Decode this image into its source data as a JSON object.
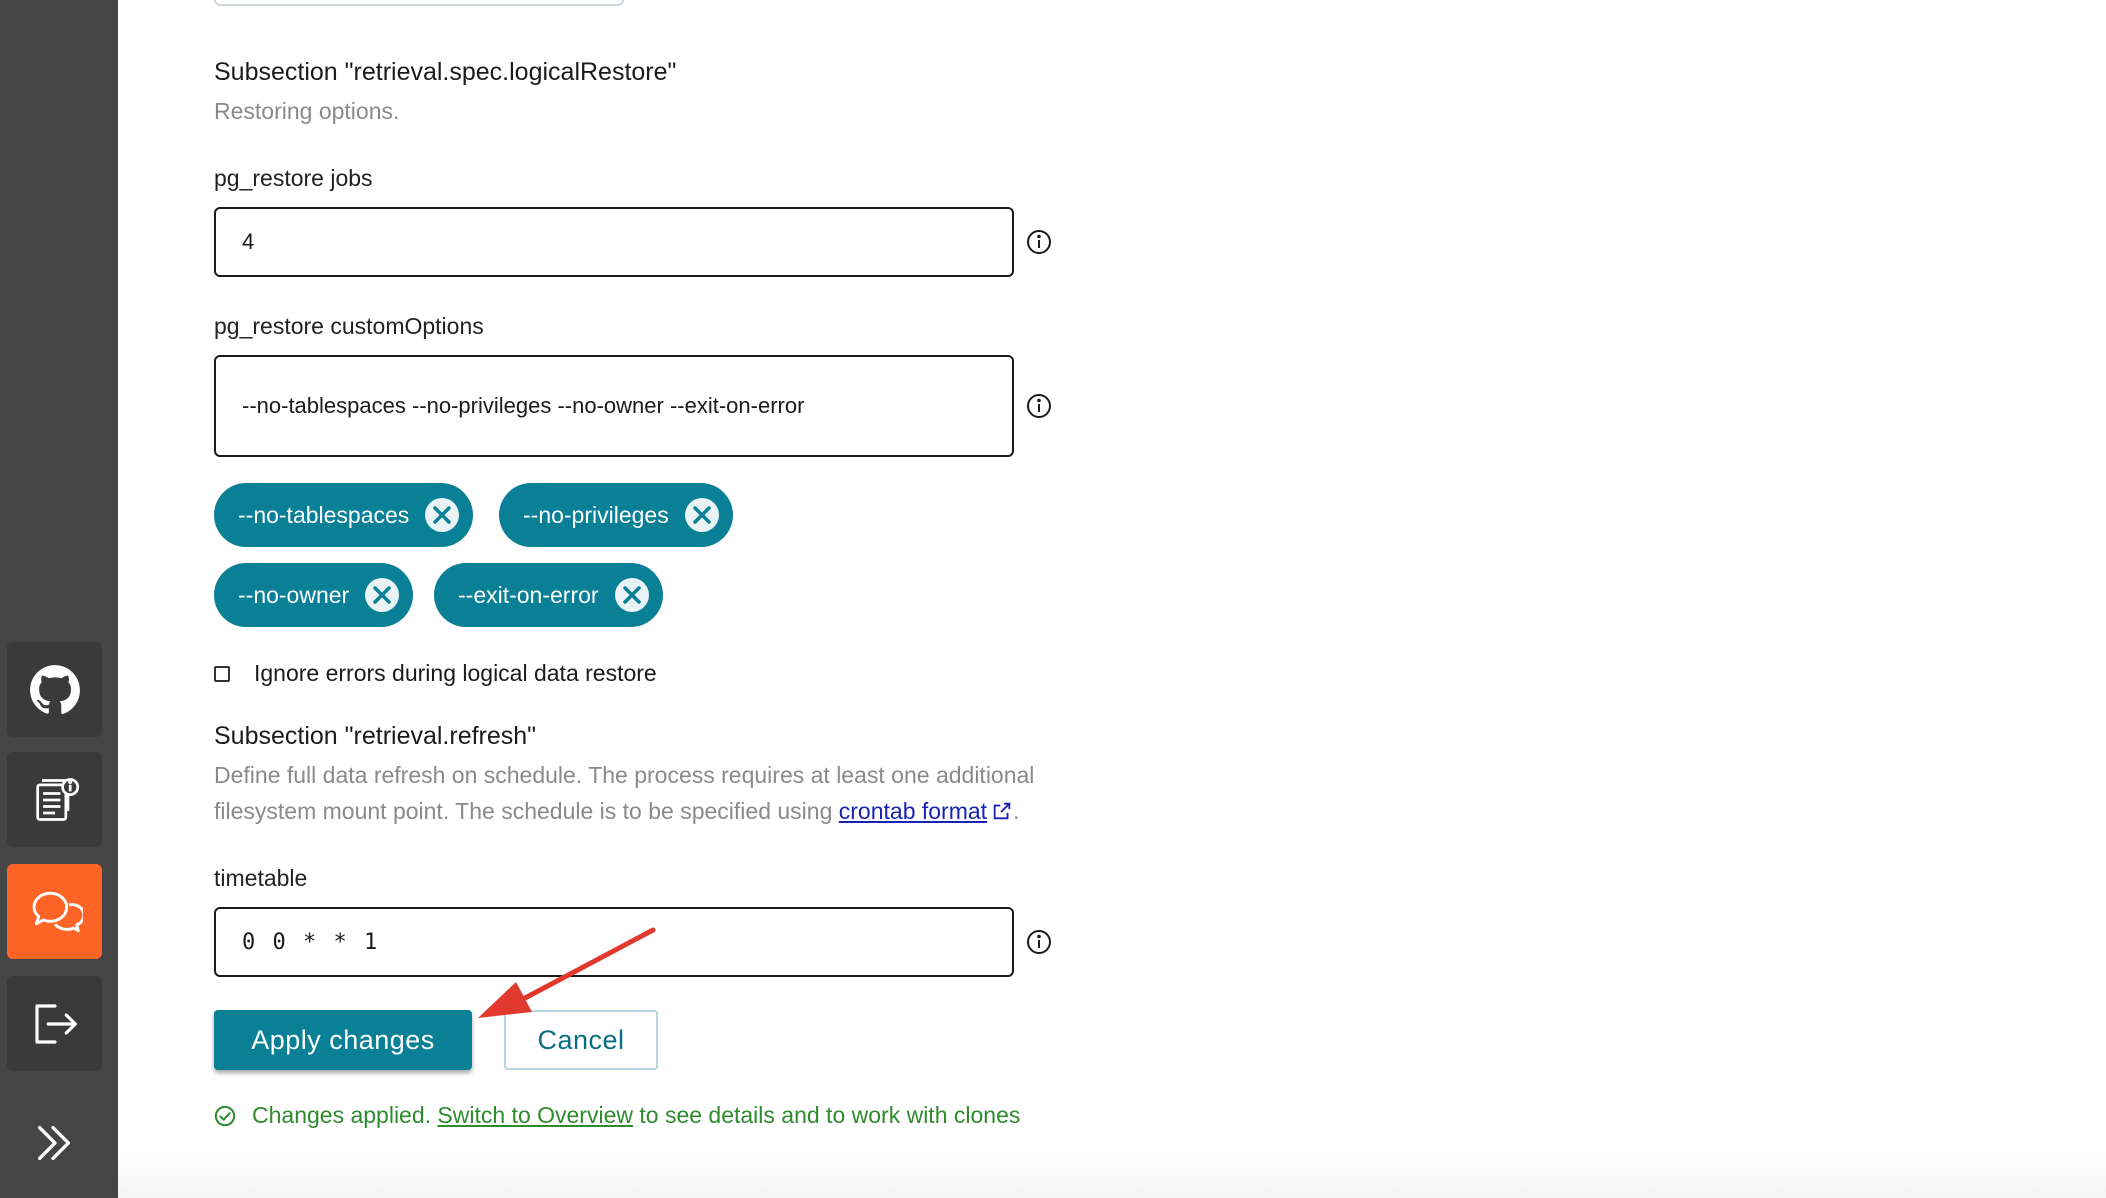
{
  "sidebar": {
    "items": [
      {
        "icon": "github-icon"
      },
      {
        "icon": "docs-icon"
      },
      {
        "icon": "chat-icon",
        "active": true
      },
      {
        "icon": "sign-out-icon"
      }
    ],
    "expand_icon": "double-chevron-right-icon"
  },
  "logical_restore": {
    "title": "Subsection \"retrieval.spec.logicalRestore\"",
    "description": "Restoring options.",
    "jobs_label": "pg_restore jobs",
    "jobs_value": "4",
    "custom_options_label": "pg_restore customOptions",
    "custom_options_value": "--no-tablespaces --no-privileges --no-owner --exit-on-error",
    "chips": [
      "--no-tablespaces",
      "--no-privileges",
      "--no-owner",
      "--exit-on-error"
    ],
    "ignore_errors_label": "Ignore errors during logical data restore",
    "ignore_errors_checked": false
  },
  "refresh": {
    "title": "Subsection \"retrieval.refresh\"",
    "description_line1": "Define full data refresh on schedule. The process requires at least one additional",
    "description_line2": "filesystem mount point. The schedule is to be specified using",
    "link_text": "crontab format",
    "description_end": ".",
    "timetable_label": "timetable",
    "timetable_value": "0 0 * * 1"
  },
  "actions": {
    "apply_label": "Apply changes",
    "cancel_label": "Cancel"
  },
  "status": {
    "prefix": "Changes applied.",
    "link_text": "Switch to Overview",
    "suffix": "to see details and to work with clones"
  },
  "colors": {
    "accent": "#0a8096",
    "sidebar": "#454545",
    "active": "#fe6426",
    "success": "#2e8b2e",
    "link": "#1a22b5",
    "annotation_arrow": "#e03a2f"
  }
}
